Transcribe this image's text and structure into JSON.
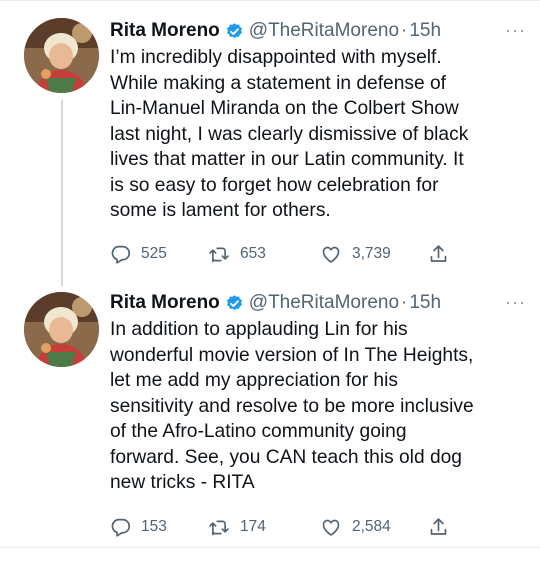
{
  "tweets": [
    {
      "name": "Rita Moreno",
      "handle": "@TheRitaMoreno",
      "separator": "·",
      "time": "15h",
      "more": "···",
      "text": "I’m incredibly disappointed with myself.\nWhile making a statement in defense of\nLin-Manuel Miranda on the Colbert Show\nlast night, I was clearly dismissive of black\nlives that matter in our Latin community.  It\nis so easy to forget how celebration for\nsome is lament for others.",
      "replies": "525",
      "retweets": "653",
      "likes": "3,739",
      "icons": [
        "reply-icon",
        "retweet-icon",
        "like-icon",
        "share-icon"
      ]
    },
    {
      "name": "Rita Moreno",
      "handle": "@TheRitaMoreno",
      "separator": "·",
      "time": "15h",
      "more": "···",
      "text": "In addition to applauding Lin for his\nwonderful movie version of In The Heights,\nlet me add my appreciation for his\nsensitivity and resolve to be more inclusive\nof the Afro-Latino community going\nforward.  See, you CAN teach this old dog\nnew tricks - RITA",
      "replies": "153",
      "retweets": "174",
      "likes": "2,584",
      "icons": [
        "reply-icon",
        "retweet-icon",
        "like-icon",
        "share-icon"
      ]
    }
  ],
  "colors": {
    "verified": "#1d9bf0",
    "muted": "#536471",
    "text": "#0f1419",
    "divider": "#e6ecf0"
  }
}
